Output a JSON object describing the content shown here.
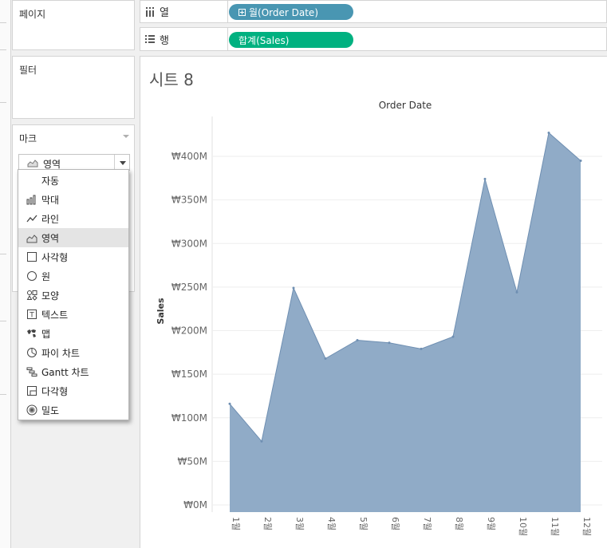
{
  "shelves": {
    "pages_label": "페이지",
    "filters_label": "필터",
    "marks_label": "마크",
    "columns": {
      "label": "열",
      "pill": "월(Order Date)",
      "color": "#4996b2"
    },
    "rows": {
      "label": "행",
      "pill": "합계(Sales)",
      "color": "#00b180"
    }
  },
  "marks_type": {
    "current": "영역",
    "options": [
      {
        "label": "자동",
        "icon": "none"
      },
      {
        "label": "막대",
        "icon": "bar-chart-icon"
      },
      {
        "label": "라인",
        "icon": "line-chart-icon"
      },
      {
        "label": "영역",
        "icon": "area-chart-icon",
        "selected": true
      },
      {
        "label": "사각형",
        "icon": "square-icon"
      },
      {
        "label": "원",
        "icon": "circle-icon"
      },
      {
        "label": "모양",
        "icon": "shapes-icon"
      },
      {
        "label": "텍스트",
        "icon": "text-icon"
      },
      {
        "label": "맵",
        "icon": "map-icon"
      },
      {
        "label": "파이 차트",
        "icon": "pie-chart-icon"
      },
      {
        "label": "Gantt 차트",
        "icon": "gantt-icon"
      },
      {
        "label": "다각형",
        "icon": "polygon-icon"
      },
      {
        "label": "밀도",
        "icon": "density-icon"
      }
    ]
  },
  "sheet": {
    "title": "시트 8"
  },
  "chart_data": {
    "type": "area",
    "title": "Order Date",
    "xlabel": "",
    "ylabel": "Sales",
    "categories": [
      "1월",
      "2월",
      "3월",
      "4월",
      "5월",
      "6월",
      "7월",
      "8월",
      "9월",
      "10월",
      "11월",
      "12월"
    ],
    "values": [
      116,
      73,
      249,
      168,
      189,
      186,
      179,
      193,
      374,
      244,
      427,
      395
    ],
    "y_unit": "M (₩)",
    "yticks": [
      "₩0M",
      "₩50M",
      "₩100M",
      "₩150M",
      "₩200M",
      "₩250M",
      "₩300M",
      "₩350M",
      "₩400M"
    ],
    "ylim": [
      0,
      460
    ],
    "fill_color": "#8aa7c4",
    "line_color": "#6f8fb2",
    "grid": true
  }
}
